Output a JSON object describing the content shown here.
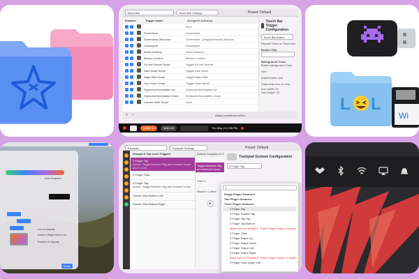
{
  "card2": {
    "search_placeholder": "Touch Bar",
    "settings_label": "Touch Bar Settings",
    "preset_label": "Preset: Default",
    "columns": [
      "Enabled",
      "Trigger Name",
      "Assigned Action(s)"
    ],
    "rows": [
      {
        "name": "",
        "action": "Kill X"
      },
      {
        "name": "Screenshot",
        "action": "Screenshot"
      },
      {
        "name": "Screenshot (Window)",
        "action": "Screenshot - (Display/Screen) Window"
      },
      {
        "name": "Launchpad",
        "action": "Launchpad"
      },
      {
        "name": "Show Desktop",
        "action": "Show Desktop"
      },
      {
        "name": "Mission Control",
        "action": "Mission Control"
      },
      {
        "name": "Do Not Disturb Script",
        "action": "Toggle Do Not Disturb"
      },
      {
        "name": "Dark Mode Script",
        "action": "Toggle Dark Mode"
      },
      {
        "name": "Night Shift Script",
        "action": "Toggle Night Shift"
      },
      {
        "name": "Your Voice Script",
        "action": "Toggle Voice Mode"
      },
      {
        "name": "Keyboard Illumination Up",
        "action": "Keyboard Illumination Up"
      },
      {
        "name": "Keyboard Illumination Down",
        "action": "Keyboard Illumination Down"
      },
      {
        "name": "Volume Mute Script",
        "action": "Mute"
      }
    ],
    "side_title": "Touch Bar Trigger Configuration",
    "side_button": "Touch Bar Button",
    "side_option": "Repeat / Hold on Touch Bar",
    "side_button_title_label": "Button Title:",
    "side_button_title_value": "",
    "side_bg_label": "Background Color:",
    "side_bg_value": "Button background Color",
    "side_size": "Size",
    "side_adjust": "Adjust button size",
    "side_show_only": "Show only icon, no text",
    "side_icon_width": "Icon width: 22",
    "side_icon_height": "Icon height: 22",
    "bottom_attach": "Attach predefined action",
    "touchbar": {
      "price1": "$7801.11",
      "price2": "$261.08",
      "datetime": "Thu May 24 2:38 PM"
    }
  },
  "card4": {
    "labels": [
      "Add Gradient",
      "end of display",
      "Bottom Right Menu bar",
      "Bottom of display",
      "Done"
    ]
  },
  "card5": {
    "search_placeholder": "Trackpad",
    "settings_label": "Trackpad Settings",
    "preset_label": "Preset: Default",
    "col_groups": "Groups & Top Level Triggers",
    "col_actions": "Actions Assigned to Selected T...",
    "list": [
      {
        "title": "3 Finger Tap",
        "sub": "Action: Toggle Between Big and Normal Cursor and 1 more"
      },
      {
        "title": "3 Finger Click",
        "sub": ""
      },
      {
        "title": "4 Finger Tap",
        "sub": "Action: Toggle Between Big and Normal Cursor"
      },
      {
        "title": "Corner Click Bottom Left",
        "sub": ""
      },
      {
        "title": "Corner Click Bottom Right",
        "sub": ""
      }
    ],
    "action1": "Toggle Between Big and Normal Cursor",
    "action2": "Cmd X",
    "action3": "Mission Control",
    "config_title": "Trackpad Gesture Configuration",
    "config_select": "3 Finger Tap",
    "menu": [
      {
        "t": "Single Finger Gestures",
        "k": "group"
      },
      {
        "t": "Two Finger Gestures",
        "k": "group"
      },
      {
        "t": "Three Finger Gestures",
        "k": "group"
      },
      {
        "t": "3 Finger Tap",
        "k": "sel"
      },
      {
        "t": "3 Finger Double-Tap",
        "k": "item"
      },
      {
        "t": "3 Finger Tap Top",
        "k": "item"
      },
      {
        "t": "3 Finger Tap Bottom",
        "k": "item"
      },
      {
        "t": "Make sure to DISABLE 'Three Finger Drag' in System Preferences or Trackpad",
        "k": "red"
      },
      {
        "t": "3 Finger Click",
        "k": "item"
      },
      {
        "t": "3 Finger Swipe Up",
        "k": "item"
      },
      {
        "t": "3 Finger Swipe Down",
        "k": "item"
      },
      {
        "t": "3 Finger Swipe Left",
        "k": "item"
      },
      {
        "t": "3 Finger Swipe Right",
        "k": "item"
      },
      {
        "t": "Make sure to DISABLE 'Three Finger Swipe' in System Preferences or Trackpad",
        "k": "red"
      },
      {
        "t": "3 Finger Click Upper Left",
        "k": "item"
      }
    ]
  },
  "colors": {
    "background": "#d6a3e6",
    "accent_blue": "#3b82f6",
    "accent_purple": "#a23b9b",
    "folder_pink": "#f38cb8",
    "folder_blue": "#5a8ff2"
  }
}
